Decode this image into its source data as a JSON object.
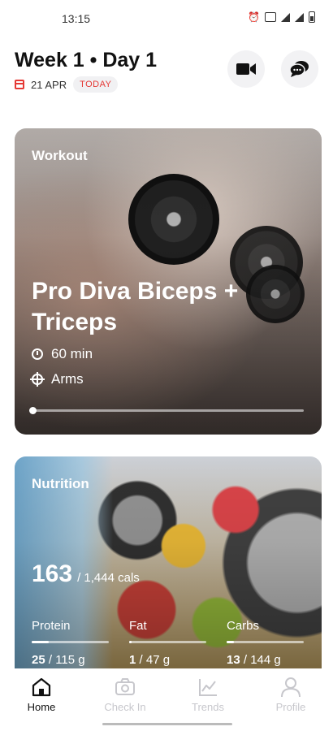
{
  "status_bar": {
    "time": "13:15"
  },
  "header": {
    "title": "Week 1 • Day 1",
    "date": "21 APR",
    "today_badge": "TODAY",
    "icons": [
      "calendar-icon",
      "video-icon",
      "chat-icon"
    ]
  },
  "workout": {
    "label": "Workout",
    "title": "Pro Diva Biceps + Triceps",
    "duration": "60 min",
    "target": "Arms",
    "progress": 0.0,
    "icons": [
      "clock-icon",
      "target-icon"
    ]
  },
  "nutrition": {
    "label": "Nutrition",
    "calories": "163",
    "calories_total": "/ 1,444 cals",
    "macros": [
      {
        "name": "Protein",
        "current": "25",
        "goal": "/ 115 g",
        "progress": 0.22
      },
      {
        "name": "Fat",
        "current": "1",
        "goal": "/ 47 g",
        "progress": 0.03
      },
      {
        "name": "Carbs",
        "current": "13",
        "goal": "/ 144 g",
        "progress": 0.09
      }
    ]
  },
  "bottom_nav": {
    "items": [
      {
        "label": "Home",
        "icon": "home-icon",
        "active": true
      },
      {
        "label": "Check In",
        "icon": "camera-icon",
        "active": false
      },
      {
        "label": "Trends",
        "icon": "trends-icon",
        "active": false
      },
      {
        "label": "Profile",
        "icon": "profile-icon",
        "active": false
      }
    ]
  },
  "colors": {
    "accent": "#e53935",
    "inactive_nav": "#c7c7cc",
    "badge_bg": "#f1f1f3"
  }
}
